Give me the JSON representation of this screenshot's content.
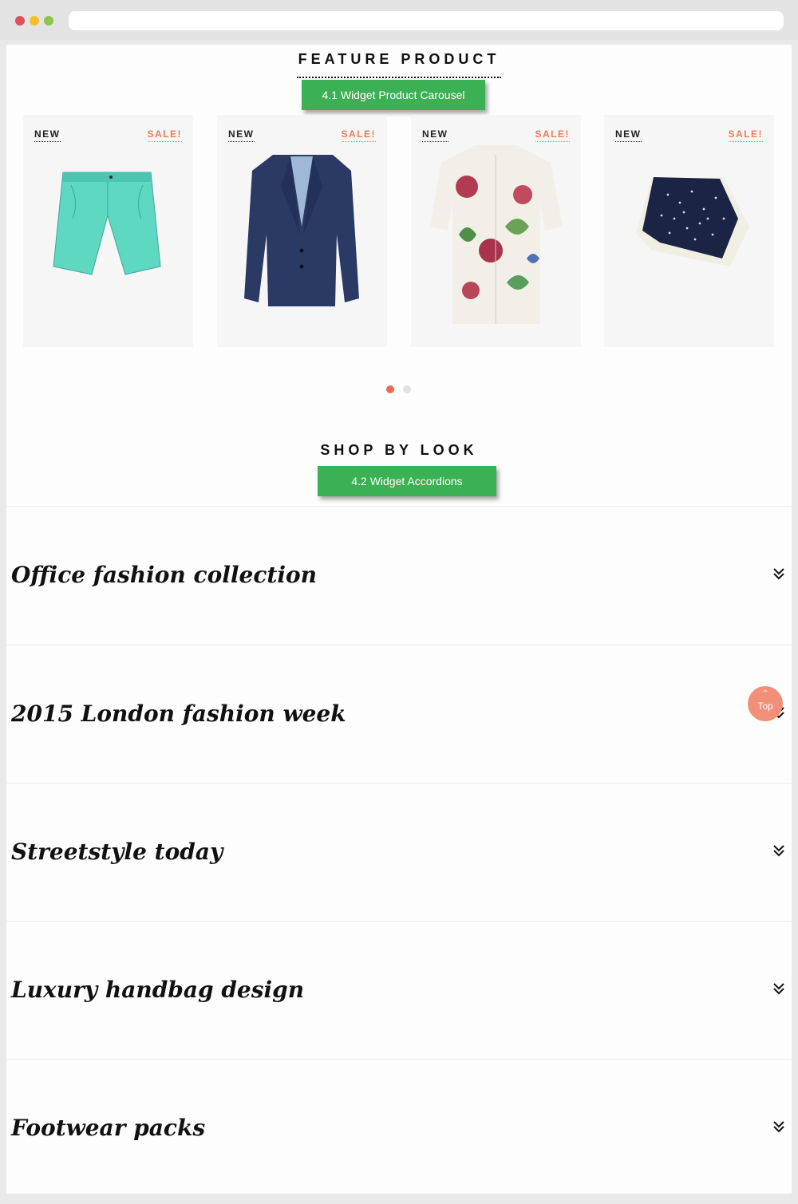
{
  "feature": {
    "title": "FEATURE PRODUCT",
    "widget_label": "4.1 Widget Product Carousel",
    "products": [
      {
        "new": "NEW",
        "sale": "SALE!",
        "image": "mint chino shorts"
      },
      {
        "new": "NEW",
        "sale": "SALE!",
        "image": "navy blazer"
      },
      {
        "new": "NEW",
        "sale": "SALE!",
        "image": "floral print shirt"
      },
      {
        "new": "NEW",
        "sale": "SALE!",
        "image": "navy pocket square"
      }
    ],
    "pager": {
      "pages": 2,
      "active": 1
    }
  },
  "shop_by_look": {
    "title": "SHOP BY LOOK",
    "widget_label": "4.2 Widget Accordions",
    "items": [
      {
        "title": "Office fashion collection"
      },
      {
        "title": "2015 London fashion week"
      },
      {
        "title": "Streetstyle today"
      },
      {
        "title": "Luxury handbag design"
      },
      {
        "title": "Footwear packs"
      }
    ]
  },
  "back_to_top": {
    "label": "Top",
    "icon": "chevron-up-icon"
  },
  "colors": {
    "widget_green": "#3bb054",
    "sale_orange": "#ee7a5c",
    "pager_active": "#ee6a4e",
    "top_button": "#f28f78"
  }
}
